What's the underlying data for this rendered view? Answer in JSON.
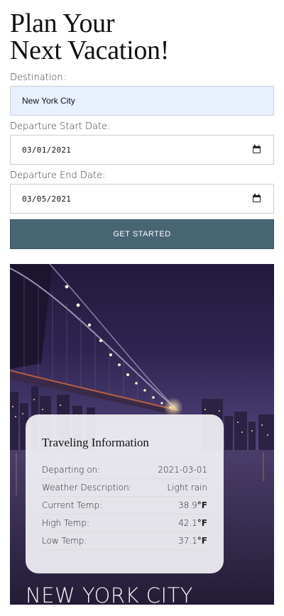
{
  "page": {
    "title_line1": "Plan Your",
    "title_line2": "Next Vacation!"
  },
  "form": {
    "destination_label": "Destination:",
    "destination_value": "New York City",
    "start_label": "Departure Start Date:",
    "start_value": "03/01/2021",
    "end_label": "Departure End Date:",
    "end_value": "03/05/2021",
    "submit_label": "GET STARTED"
  },
  "hero": {
    "city_label": "NEW YORK CITY"
  },
  "travel_info": {
    "heading": "Traveling Information",
    "rows": [
      {
        "label": "Departing on:",
        "value": "2021-03-01",
        "unit": ""
      },
      {
        "label": "Weather Description:",
        "value": "Light rain",
        "unit": ""
      },
      {
        "label": "Current Temp:",
        "value": "38.9",
        "unit": "°F"
      },
      {
        "label": "High Temp:",
        "value": "42.1",
        "unit": "°F"
      },
      {
        "label": "Low Temp:",
        "value": "37.1",
        "unit": "°F"
      }
    ]
  },
  "icons": {
    "date_picker": "calendar-icon"
  },
  "colors": {
    "button_bg": "#486574",
    "destination_bg": "#e8f0fe",
    "hero_sky": "#2f2450"
  }
}
